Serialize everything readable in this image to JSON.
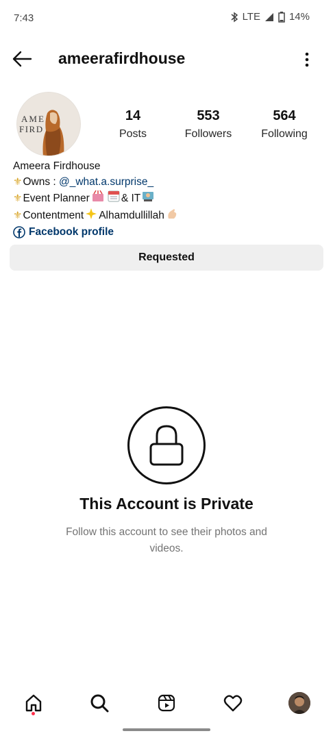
{
  "status_bar": {
    "time": "7:43",
    "network": "LTE",
    "battery": "14%"
  },
  "header": {
    "username": "ameerafirdhouse"
  },
  "profile": {
    "avatar_text_top": "AME   A",
    "avatar_text_bottom": "FIRD   SE",
    "stats": [
      {
        "value": "14",
        "label": "Posts"
      },
      {
        "value": "553",
        "label": "Followers"
      },
      {
        "value": "564",
        "label": "Following"
      }
    ],
    "bio": {
      "name": "Ameera Firdhouse",
      "line1_prefix": "Owns : ",
      "line1_mention": "@_what.a.surprise_",
      "line2": "Event Planner",
      "line2_suffix": " & IT",
      "line3": "Contentment ",
      "line3_suffix": "Alhamdullillah",
      "facebook": "Facebook profile"
    }
  },
  "actions": {
    "requested_label": "Requested"
  },
  "private": {
    "title": "This Account is Private",
    "subtitle": "Follow this account to see their photos and videos."
  },
  "colors": {
    "link": "#00376b",
    "button_bg": "#efefef",
    "notification_dot": "#ff2d4a"
  }
}
